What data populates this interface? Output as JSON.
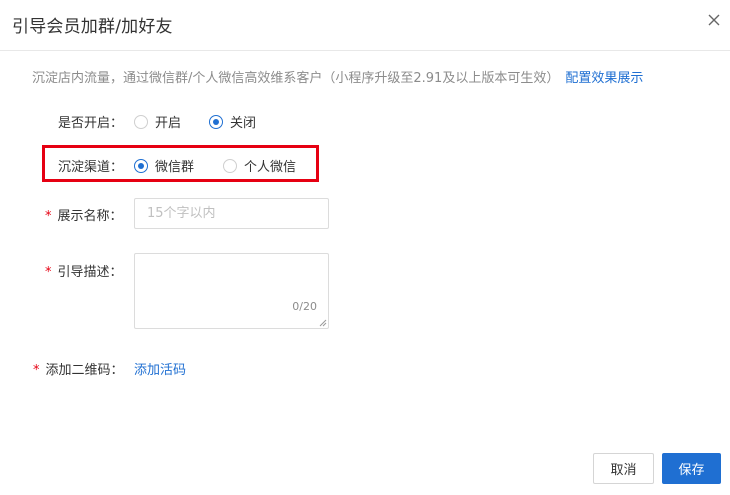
{
  "dialog": {
    "title": "引导会员加群/加好友",
    "close_icon": "close-icon"
  },
  "tip": {
    "text": "沉淀店内流量，通过微信群/个人微信高效维系客户（小程序升级至2.91及以上版本可生效）",
    "link": "配置效果展示"
  },
  "form": {
    "enable": {
      "label": "是否开启：",
      "options": [
        "开启",
        "关闭"
      ],
      "selected": "关闭"
    },
    "channel": {
      "label": "沉淀渠道：",
      "options": [
        "微信群",
        "个人微信"
      ],
      "selected": "微信群"
    },
    "display_name": {
      "required_mark": "*",
      "label": "展示名称：",
      "value": "",
      "placeholder": "15个字以内"
    },
    "description": {
      "required_mark": "*",
      "label": "引导描述：",
      "value": "",
      "counter": "0/20"
    },
    "qrcode": {
      "required_mark": "*",
      "label": "添加二维码：",
      "link": "添加活码"
    }
  },
  "footer": {
    "cancel_label": "取消",
    "save_label": "保存"
  },
  "colors": {
    "accent": "#1f6fd2",
    "required": "#e60012",
    "highlight_border": "#e60012"
  }
}
